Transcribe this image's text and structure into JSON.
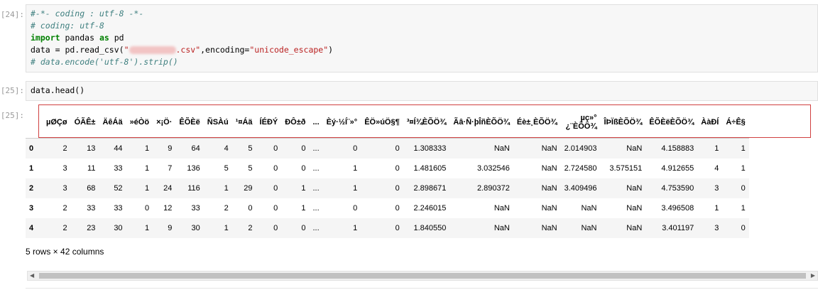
{
  "cells": [
    {
      "prompt": "[24]:",
      "lines": [
        [
          {
            "cls": "cm",
            "text": "#-*- coding : utf-8 -*-"
          }
        ],
        [
          {
            "cls": "cm",
            "text": "# coding: utf-8"
          }
        ],
        [
          {
            "cls": "kw",
            "text": "import"
          },
          {
            "cls": "nm",
            "text": " pandas "
          },
          {
            "cls": "kw",
            "text": "as"
          },
          {
            "cls": "nm",
            "text": " pd"
          }
        ],
        [
          {
            "cls": "nm",
            "text": "data = pd.read_csv("
          },
          {
            "cls": "st",
            "text": "\""
          },
          {
            "cls": "blur",
            "text": ""
          },
          {
            "cls": "st",
            "text": ".csv\""
          },
          {
            "cls": "nm",
            "text": ",encoding="
          },
          {
            "cls": "st",
            "text": "\"unicode_escape\""
          },
          {
            "cls": "nm",
            "text": ")"
          }
        ],
        [
          {
            "cls": "cm",
            "text": "# data.encode('utf-8').strip()"
          }
        ]
      ]
    },
    {
      "prompt": "[25]:",
      "lines": [
        [
          {
            "cls": "nm",
            "text": "data.head()"
          }
        ]
      ]
    }
  ],
  "output_prompt": "[25]:",
  "table": {
    "columns": [
      "µØÇø",
      "ÓÃÊ±",
      "ÄêÁä",
      "»éÒö",
      "×¡Ö·",
      "ÊÕÈë",
      "ÑSÀú",
      "¹¤Áä",
      "ÍÉÐÝ",
      "ÐÔ±ð",
      "...",
      "Èý·½Í¨»°",
      "ÊÖ»úÖ§¶",
      "³¤Í¾ÈÕÖ¾",
      "Ãâ·Ñ·þÎñÈÕÖ¾",
      "Éè±¸ÈÕÖ¾",
      "µç»°\n¿¨ÈÕÖ¾",
      "ÎÞÏßÈÕÖ¾",
      "ÊÕÈëÈÕÖ¾",
      "ÀàÐÍ",
      "Á÷Ê§"
    ],
    "rows": [
      {
        "index": "0",
        "values": [
          "2",
          "13",
          "44",
          "1",
          "9",
          "64",
          "4",
          "5",
          "0",
          "0",
          "...",
          "0",
          "0",
          "1.308333",
          "NaN",
          "NaN",
          "2.014903",
          "NaN",
          "4.158883",
          "1",
          "1"
        ]
      },
      {
        "index": "1",
        "values": [
          "3",
          "11",
          "33",
          "1",
          "7",
          "136",
          "5",
          "5",
          "0",
          "0",
          "...",
          "1",
          "0",
          "1.481605",
          "3.032546",
          "NaN",
          "2.724580",
          "3.575151",
          "4.912655",
          "4",
          "1"
        ]
      },
      {
        "index": "2",
        "values": [
          "3",
          "68",
          "52",
          "1",
          "24",
          "116",
          "1",
          "29",
          "0",
          "1",
          "...",
          "1",
          "0",
          "2.898671",
          "2.890372",
          "NaN",
          "3.409496",
          "NaN",
          "4.753590",
          "3",
          "0"
        ]
      },
      {
        "index": "3",
        "values": [
          "2",
          "33",
          "33",
          "0",
          "12",
          "33",
          "2",
          "0",
          "0",
          "1",
          "...",
          "0",
          "0",
          "2.246015",
          "NaN",
          "NaN",
          "NaN",
          "NaN",
          "3.496508",
          "1",
          "1"
        ]
      },
      {
        "index": "4",
        "values": [
          "2",
          "23",
          "30",
          "1",
          "9",
          "30",
          "1",
          "2",
          "0",
          "0",
          "...",
          "1",
          "0",
          "1.840550",
          "NaN",
          "NaN",
          "NaN",
          "NaN",
          "3.401197",
          "3",
          "0"
        ]
      }
    ]
  },
  "summary": "5 rows × 42 columns",
  "scrollbar": {
    "left_arrow": "◀",
    "right_arrow": "▶"
  }
}
